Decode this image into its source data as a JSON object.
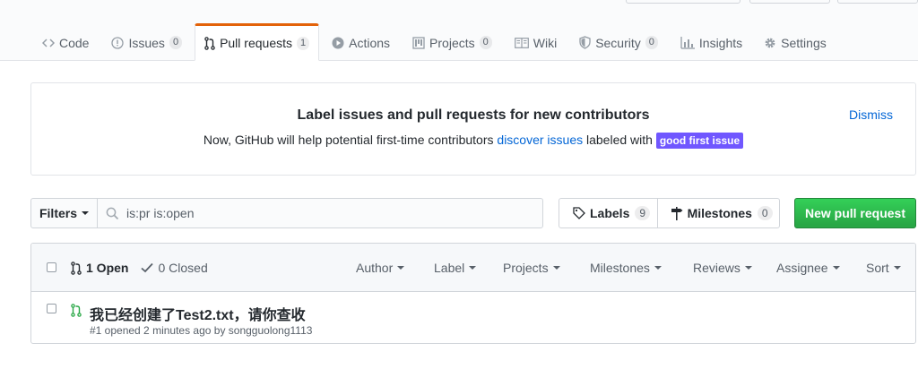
{
  "tabs": [
    {
      "label": "Code",
      "icon": "code-icon"
    },
    {
      "label": "Issues",
      "count": "0",
      "icon": "issue-opened-icon"
    },
    {
      "label": "Pull requests",
      "count": "1",
      "icon": "git-pull-request-icon",
      "selected": true
    },
    {
      "label": "Actions",
      "icon": "play-icon"
    },
    {
      "label": "Projects",
      "count": "0",
      "icon": "project-icon"
    },
    {
      "label": "Wiki",
      "icon": "book-icon"
    },
    {
      "label": "Security",
      "count": "0",
      "icon": "shield-icon"
    },
    {
      "label": "Insights",
      "icon": "graph-icon"
    },
    {
      "label": "Settings",
      "icon": "gear-icon"
    }
  ],
  "banner": {
    "title": "Label issues and pull requests for new contributors",
    "text_before": "Now, GitHub will help potential first-time contributors ",
    "link": "discover issues",
    "text_after": " labeled with ",
    "label": "good first issue",
    "label_color": "#7057ff",
    "dismiss": "Dismiss"
  },
  "filters": {
    "button": "Filters",
    "search_value": "is:pr is:open"
  },
  "labels_button": {
    "label": "Labels",
    "count": "9"
  },
  "milestones_button": {
    "label": "Milestones",
    "count": "0"
  },
  "new_pr_button": "New pull request",
  "list_header": {
    "open": "1 Open",
    "closed": "0 Closed",
    "menus": [
      "Author",
      "Label",
      "Projects",
      "Milestones",
      "Reviews",
      "Assignee",
      "Sort"
    ]
  },
  "pull_requests": [
    {
      "title": "我已经创建了Test2.txt，请你查收",
      "meta": "#1 opened 2 minutes ago by songguolong1113"
    }
  ],
  "colors": {
    "accent": "#0366d6",
    "selected_tab_border": "#e36209",
    "green_button": "#28a745",
    "open_icon": "#28a745"
  }
}
